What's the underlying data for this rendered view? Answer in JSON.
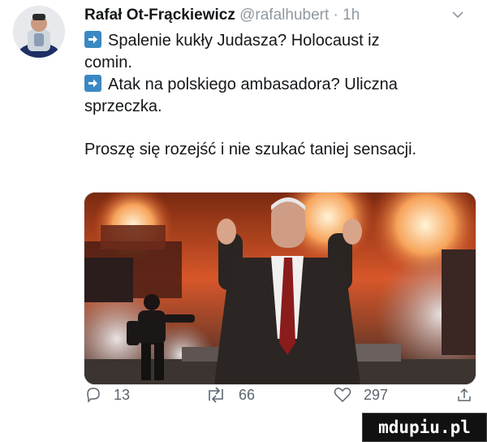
{
  "tweet": {
    "author_name": "Rafał Ot-Frąckiewicz",
    "handle": "@rafalhubert",
    "separator": "·",
    "time": "1h",
    "lines": [
      "Spalenie kukły Judasza? Holocaust iz",
      "comin.",
      "Atak na polskiego ambasadora? Uliczna",
      "sprzeczka."
    ],
    "closing": "Proszę się rozejść i nie szukać taniej sensacji.",
    "icons": {
      "avatar": "avatar-photo",
      "menu": "chevron-down-icon",
      "bullet": "arrow-right-box-icon",
      "reply": "reply-icon",
      "retweet": "retweet-icon",
      "like": "heart-icon",
      "share": "share-icon"
    },
    "stats": {
      "replies": "13",
      "retweets": "66",
      "likes": "297"
    }
  },
  "watermark": {
    "text": "mdupiu.pl"
  },
  "colors": {
    "link_gray": "#8f98a1",
    "bullet_blue": "#3b88c3",
    "icon_gray": "#5b6670"
  }
}
